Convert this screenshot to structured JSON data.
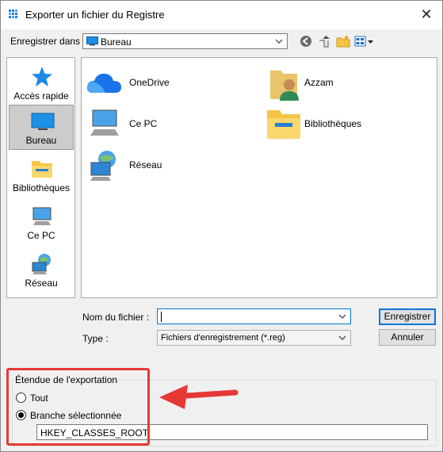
{
  "window": {
    "title": "Exporter un fichier du Registre",
    "close_glyph": "✕"
  },
  "location": {
    "label": "Enregistrer dans :",
    "value": "Bureau"
  },
  "toolbar": {
    "icons": [
      "back-icon",
      "up-folder-icon",
      "new-folder-icon",
      "view-menu-icon"
    ]
  },
  "places": [
    {
      "label": "Accès rapide",
      "icon": "star-icon"
    },
    {
      "label": "Bureau",
      "icon": "desktop-icon",
      "selected": true
    },
    {
      "label": "Bibliothèques",
      "icon": "libraries-icon"
    },
    {
      "label": "Ce PC",
      "icon": "computer-icon"
    },
    {
      "label": "Réseau",
      "icon": "network-icon"
    }
  ],
  "files": [
    {
      "label": "OneDrive",
      "icon": "onedrive-icon"
    },
    {
      "label": "Azzam",
      "icon": "user-folder-icon"
    },
    {
      "label": "Ce PC",
      "icon": "computer-icon"
    },
    {
      "label": "Bibliothèques",
      "icon": "libraries-icon"
    },
    {
      "label": "Réseau",
      "icon": "network-icon"
    }
  ],
  "filename": {
    "label": "Nom du fichier :",
    "value": ""
  },
  "filetype": {
    "label": "Type :",
    "value": "Fichiers d'enregistrement (*.reg)"
  },
  "buttons": {
    "save": "Enregistrer",
    "cancel": "Annuler"
  },
  "export_range": {
    "title": "Étendue de l'exportation",
    "all_label": "Tout",
    "branch_label": "Branche sélectionnée",
    "selected": "branch",
    "branch_value": "HKEY_CLASSES_ROOT"
  },
  "colors": {
    "annotation": "#e53935",
    "accent": "#0078d7"
  }
}
